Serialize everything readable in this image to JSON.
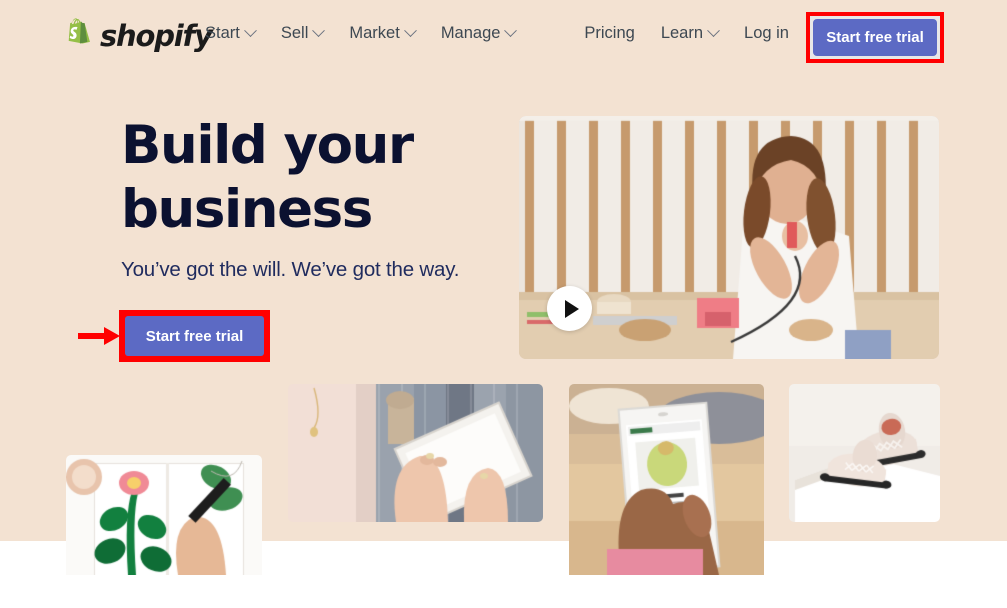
{
  "page": {
    "site": "Shopify",
    "background_color": "#f3e2d2",
    "accent_color": "#5c6ac4",
    "heading_color": "#0b1130",
    "annotation_color": "#ff0000"
  },
  "nav": {
    "logo_text": "shopify",
    "logo_icon": "shopify-bag-icon",
    "logo_color": "#95bf47",
    "links": [
      {
        "label": "Start",
        "has_dropdown": true
      },
      {
        "label": "Sell",
        "has_dropdown": true
      },
      {
        "label": "Market",
        "has_dropdown": true
      },
      {
        "label": "Manage",
        "has_dropdown": true
      }
    ],
    "right_links": [
      {
        "label": "Pricing",
        "has_dropdown": false
      },
      {
        "label": "Learn",
        "has_dropdown": true
      },
      {
        "label": "Log in",
        "has_dropdown": false
      }
    ],
    "cta_label": "Start free trial"
  },
  "hero": {
    "title_line_1": "Build your",
    "title_line_2": "business",
    "subtitle": "You’ve got the will. We’ve got the way.",
    "cta_label": "Start free trial",
    "video": {
      "alt": "Woman working with a craft tool at a wooden table",
      "play_icon": "play-icon"
    }
  },
  "gallery": [
    {
      "alt": "Hand drawing pink flowers in a white notebook"
    },
    {
      "alt": "Hands holding a tablet in front of a clothing rack"
    },
    {
      "alt": "Hand holding a phone showing an online store product page"
    },
    {
      "alt": "Pair of pink brogue shoes on a white pedestal"
    }
  ],
  "annotations": {
    "arrow_icon": "right-arrow-annotation",
    "nav_cta_box": "red-highlight-box",
    "hero_cta_box": "red-highlight-box"
  }
}
